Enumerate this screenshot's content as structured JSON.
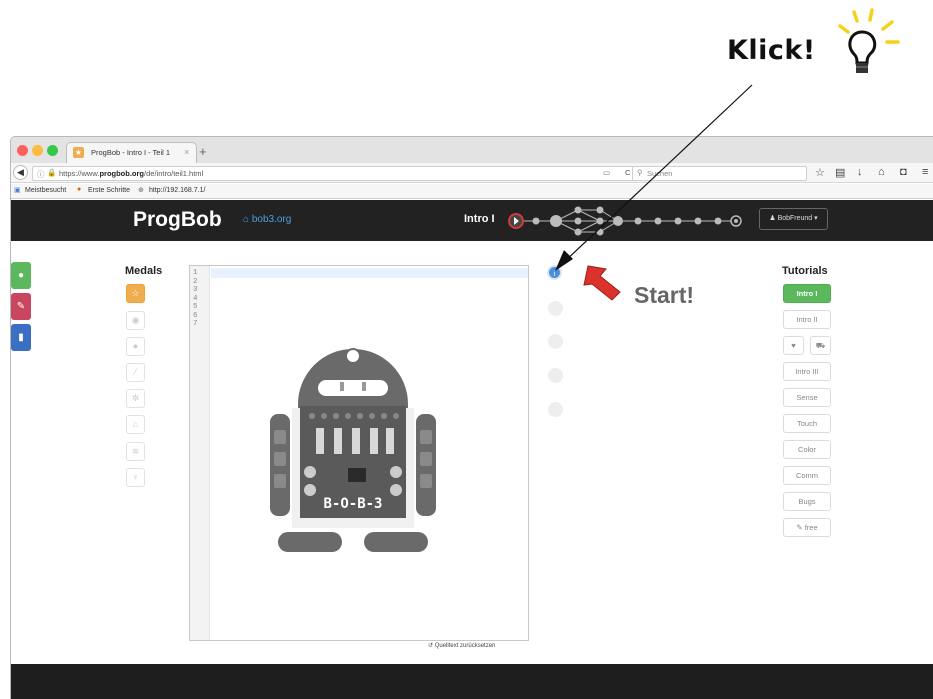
{
  "annotation": {
    "click_label": "Klick!",
    "start_label": "Start!"
  },
  "browser": {
    "tab_title": "ProgBob - Intro I - Teil 1",
    "tab_close": "×",
    "new_tab": "+",
    "url_secure_prefix": "https://www.",
    "url_domain": "progbob.org",
    "url_path": "/de/intro/teil1.html",
    "search_placeholder": "Suchen",
    "bookmarks": [
      "Meistbesucht",
      "Erste Schritte",
      "http://192.168.7.1/"
    ]
  },
  "site": {
    "brand": "ProgBob",
    "subsite_link": "bob3.org",
    "lesson_title": "Intro I",
    "user_menu": "BobFreund ▾"
  },
  "medals": {
    "title": "Medals",
    "icons": [
      "star-icon",
      "eye-icon",
      "drop-icon",
      "wand-icon",
      "gear-icon",
      "home-icon",
      "wifi-icon",
      "trophy-icon"
    ]
  },
  "editor": {
    "line_numbers": [
      "1",
      "2",
      "3",
      "4",
      "5",
      "6",
      "7"
    ],
    "board_label": "B-O-B-3",
    "reset_link": "↺ Quelltext zurücksetzen"
  },
  "steps": {
    "active_icon": "i"
  },
  "tutorials": {
    "title": "Tutorials",
    "items": [
      "Intro I",
      "Intro II",
      "Intro III",
      "Sense",
      "Touch",
      "Color",
      "Comm",
      "Bugs",
      "free"
    ],
    "active_item": "Intro I"
  },
  "colors": {
    "header_bg": "#222222",
    "tutorial_active": "#5cb85c",
    "medal_active": "#f0ad4e",
    "step_active": "#4a90d9",
    "sidebar_green": "#5cb85c",
    "sidebar_red": "#c9465f",
    "sidebar_blue": "#3a6fc4",
    "arrow_red": "#d9332b"
  }
}
